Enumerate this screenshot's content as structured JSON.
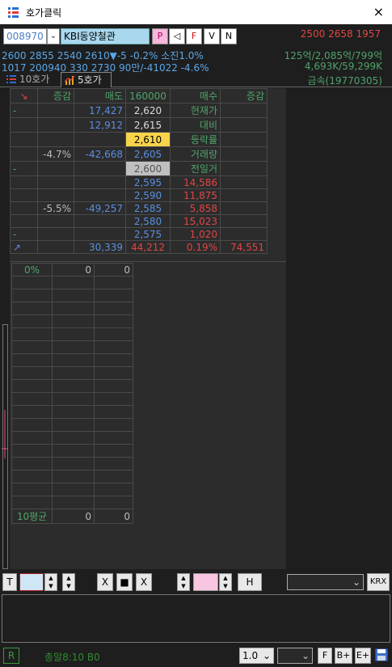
{
  "window": {
    "title": "호가클릭",
    "close_icon": "×"
  },
  "stock": {
    "code": "008970",
    "name": "KBI동양철관",
    "buttons": [
      "P",
      "◁",
      "F",
      "V",
      "N"
    ],
    "quotes": "2500 2658 1957"
  },
  "info": {
    "line1_left": "2600 2855 2540 2610▼-5 -0.2% 소진1.0%",
    "line1_right": "125억/2,085억/799억",
    "line2_left": "1017 200940 330 2730 90만/-41022 -4.6%",
    "line2_right": "4,693K/59,299K",
    "sector": "금속(19770305)"
  },
  "tabs": [
    "10호가",
    "5호가"
  ],
  "orderbook": {
    "header": {
      "marker": "↘",
      "change_left": "증감",
      "ask": "매도",
      "center": "160000",
      "bid": "매수",
      "change_right": "증감"
    },
    "rows": [
      {
        "mark": "-",
        "chg": "",
        "ask": "17,427",
        "price": "2,620",
        "pclass": "white",
        "label": "현재가",
        "lclass": "green",
        "chg2": ""
      },
      {
        "mark": "",
        "chg": "",
        "ask": "12,912",
        "price": "2,615",
        "pclass": "white",
        "label": "대비",
        "lclass": "green",
        "chg2": ""
      },
      {
        "mark": "",
        "chg": "",
        "ask": "",
        "price": "2,610",
        "pclass": "cur",
        "label": "등락률",
        "lclass": "green",
        "chg2": ""
      },
      {
        "mark": "",
        "chg": "-4.7%",
        "ask": "-42,668",
        "price": "2,605",
        "pclass": "blue",
        "label": "거래량",
        "lclass": "green",
        "chg2": ""
      },
      {
        "mark": "-",
        "chg": "",
        "ask": "",
        "price": "2,600",
        "pclass": "prev",
        "label": "전일거",
        "lclass": "green",
        "chg2": ""
      },
      {
        "mark": "",
        "chg": "",
        "ask": "",
        "price": "2,595",
        "pclass": "blue",
        "label": "14,586",
        "lclass": "red",
        "chg2": ""
      },
      {
        "mark": "",
        "chg": "",
        "ask": "",
        "price": "2,590",
        "pclass": "blue",
        "label": "11,875",
        "lclass": "red",
        "chg2": ""
      },
      {
        "mark": "",
        "chg": "-5.5%",
        "ask": "-49,257",
        "price": "2,585",
        "pclass": "blue",
        "label": "5,858",
        "lclass": "red",
        "chg2": ""
      },
      {
        "mark": "",
        "chg": "",
        "ask": "",
        "price": "2,580",
        "pclass": "blue",
        "label": "15,023",
        "lclass": "red",
        "chg2": ""
      },
      {
        "mark": "-",
        "chg": "",
        "ask": "",
        "price": "2,575",
        "pclass": "blue",
        "label": "1,020",
        "lclass": "red",
        "chg2": ""
      }
    ],
    "total": {
      "mark": "↗",
      "chg": "",
      "ask": "30,339",
      "price": "44,212",
      "label": "0.19%",
      "chg2": "74,551"
    }
  },
  "stats": {
    "top": {
      "a": "0%",
      "b": "0",
      "c": "0"
    },
    "bottom": {
      "a": "10평균",
      "b": "0",
      "c": "0"
    }
  },
  "controls": {
    "t_label": "T",
    "x1": "X",
    "stop": "■",
    "x2": "X",
    "h_label": "H",
    "krx_label": "KRX"
  },
  "bottom": {
    "r_label": "R",
    "status": "총알8:10  B0",
    "zoom": "1.0",
    "btn_f": "F",
    "btn_bplus": "B+",
    "btn_eplus": "E+"
  },
  "colors": {
    "up": "#e24545",
    "down": "#5a8fe0",
    "label": "#4fa36a",
    "current": "#f7d44a"
  }
}
